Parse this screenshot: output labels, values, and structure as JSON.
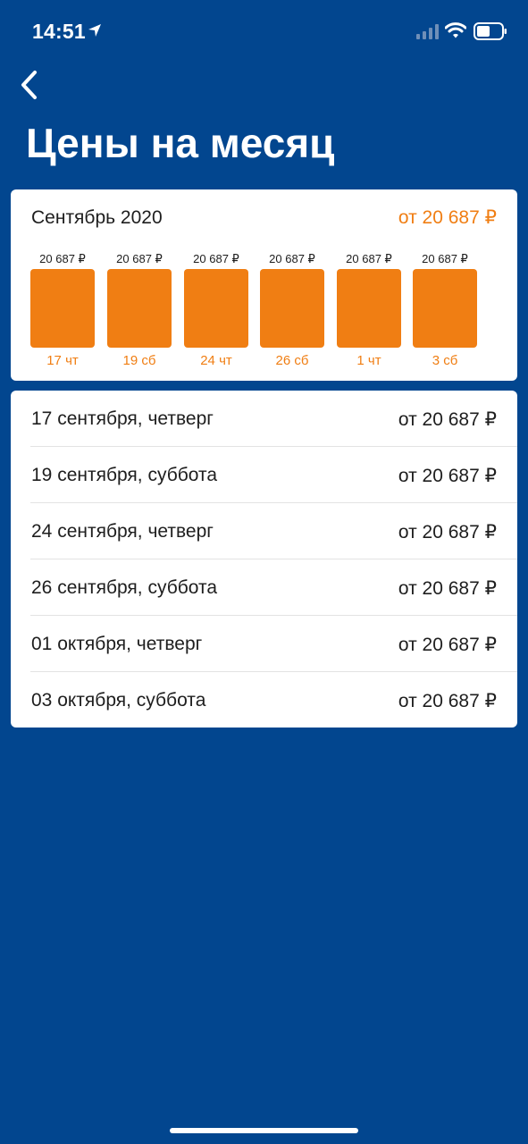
{
  "status_bar": {
    "time": "14:51",
    "icons": [
      "location-arrow-icon",
      "signal-icon",
      "wifi-icon",
      "battery-icon"
    ]
  },
  "header": {
    "back_icon": "chevron-left-icon",
    "title": "Цены на месяц"
  },
  "month_card": {
    "month": "Сентябрь 2020",
    "min_price": "от 20 687 ₽",
    "bars": [
      {
        "price": "20 687 ₽",
        "day": "17 чт"
      },
      {
        "price": "20 687 ₽",
        "day": "19 сб"
      },
      {
        "price": "20 687 ₽",
        "day": "24 чт"
      },
      {
        "price": "20 687 ₽",
        "day": "26 сб"
      },
      {
        "price": "20 687 ₽",
        "day": "1 чт"
      },
      {
        "price": "20 687 ₽",
        "day": "3 сб"
      }
    ]
  },
  "dates_list": [
    {
      "date": "17 сентября, четверг",
      "price": "от 20 687 ₽"
    },
    {
      "date": "19 сентября, суббота",
      "price": "от 20 687 ₽"
    },
    {
      "date": "24 сентября, четверг",
      "price": "от 20 687 ₽"
    },
    {
      "date": "26 сентября, суббота",
      "price": "от 20 687 ₽"
    },
    {
      "date": "01 октября, четверг",
      "price": "от 20 687 ₽"
    },
    {
      "date": "03 октября, суббота",
      "price": "от 20 687 ₽"
    }
  ],
  "colors": {
    "background": "#02468f",
    "accent": "#f07e13",
    "card": "#ffffff",
    "text": "#1e1e1e"
  }
}
